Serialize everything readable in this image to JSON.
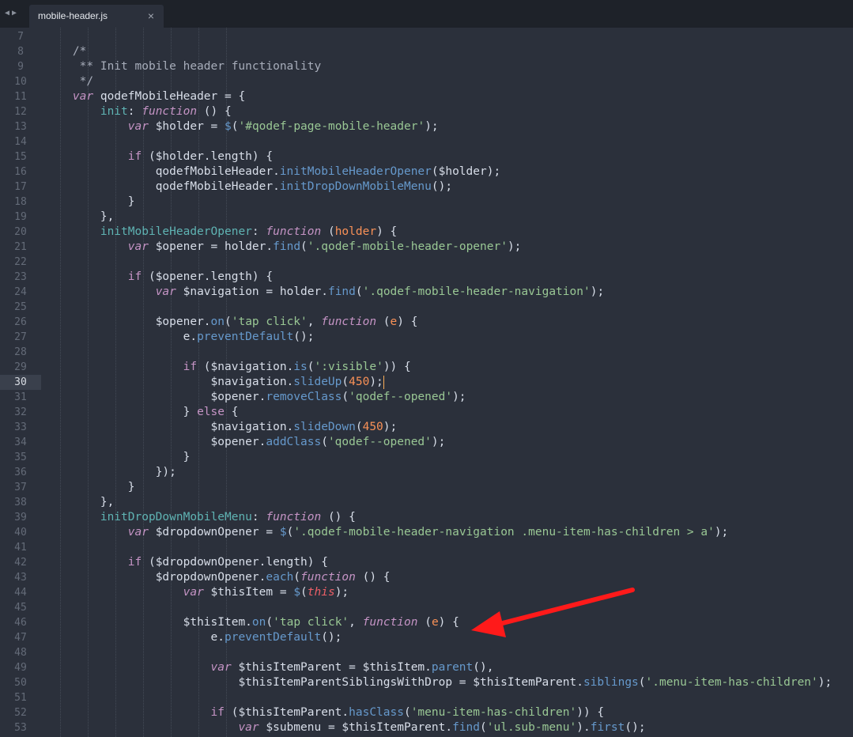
{
  "editor": {
    "tab": {
      "label": "mobile-header.js",
      "close_glyph": "×",
      "active": true
    },
    "cursor_line": 30,
    "lines": [
      {
        "n": 7,
        "i": 0,
        "tokens": []
      },
      {
        "n": 8,
        "i": 2,
        "tokens": [
          {
            "t": "/*",
            "c": "c"
          }
        ]
      },
      {
        "n": 9,
        "i": 2,
        "tokens": [
          {
            "t": " ** Init mobile header functionality",
            "c": "c"
          }
        ]
      },
      {
        "n": 10,
        "i": 2,
        "tokens": [
          {
            "t": " */",
            "c": "c"
          }
        ]
      },
      {
        "n": 11,
        "i": 2,
        "tokens": [
          {
            "t": "var",
            "c": "k"
          },
          {
            "t": " qodefMobileHeader ",
            "c": "v"
          },
          {
            "t": "=",
            "c": "v"
          },
          {
            "t": " {",
            "c": "v"
          }
        ]
      },
      {
        "n": 12,
        "i": 4,
        "tokens": [
          {
            "t": "init",
            "c": "pr"
          },
          {
            "t": ": ",
            "c": "v"
          },
          {
            "t": "function",
            "c": "k"
          },
          {
            "t": " () {",
            "c": "v"
          }
        ]
      },
      {
        "n": 13,
        "i": 6,
        "tokens": [
          {
            "t": "var",
            "c": "k"
          },
          {
            "t": " $holder ",
            "c": "v"
          },
          {
            "t": "=",
            "c": "v"
          },
          {
            "t": " ",
            "c": "v"
          },
          {
            "t": "$",
            "c": "f"
          },
          {
            "t": "(",
            "c": "v"
          },
          {
            "t": "'#qodef-page-mobile-header'",
            "c": "s"
          },
          {
            "t": ");",
            "c": "v"
          }
        ]
      },
      {
        "n": 14,
        "i": 0,
        "tokens": []
      },
      {
        "n": 15,
        "i": 6,
        "tokens": [
          {
            "t": "if",
            "c": "kk"
          },
          {
            "t": " ($holder.length) {",
            "c": "v"
          }
        ]
      },
      {
        "n": 16,
        "i": 8,
        "tokens": [
          {
            "t": "qodefMobileHeader.",
            "c": "v"
          },
          {
            "t": "initMobileHeaderOpener",
            "c": "f"
          },
          {
            "t": "($holder);",
            "c": "v"
          }
        ]
      },
      {
        "n": 17,
        "i": 8,
        "tokens": [
          {
            "t": "qodefMobileHeader.",
            "c": "v"
          },
          {
            "t": "initDropDownMobileMenu",
            "c": "f"
          },
          {
            "t": "();",
            "c": "v"
          }
        ]
      },
      {
        "n": 18,
        "i": 6,
        "tokens": [
          {
            "t": "}",
            "c": "v"
          }
        ]
      },
      {
        "n": 19,
        "i": 4,
        "tokens": [
          {
            "t": "},",
            "c": "v"
          }
        ]
      },
      {
        "n": 20,
        "i": 4,
        "tokens": [
          {
            "t": "initMobileHeaderOpener",
            "c": "pr"
          },
          {
            "t": ": ",
            "c": "v"
          },
          {
            "t": "function",
            "c": "k"
          },
          {
            "t": " (",
            "c": "v"
          },
          {
            "t": "holder",
            "c": "p"
          },
          {
            "t": ") {",
            "c": "v"
          }
        ]
      },
      {
        "n": 21,
        "i": 6,
        "tokens": [
          {
            "t": "var",
            "c": "k"
          },
          {
            "t": " $opener ",
            "c": "v"
          },
          {
            "t": "=",
            "c": "v"
          },
          {
            "t": " holder.",
            "c": "v"
          },
          {
            "t": "find",
            "c": "f"
          },
          {
            "t": "(",
            "c": "v"
          },
          {
            "t": "'.qodef-mobile-header-opener'",
            "c": "s"
          },
          {
            "t": ");",
            "c": "v"
          }
        ]
      },
      {
        "n": 22,
        "i": 0,
        "tokens": []
      },
      {
        "n": 23,
        "i": 6,
        "tokens": [
          {
            "t": "if",
            "c": "kk"
          },
          {
            "t": " ($opener.length) {",
            "c": "v"
          }
        ]
      },
      {
        "n": 24,
        "i": 8,
        "tokens": [
          {
            "t": "var",
            "c": "k"
          },
          {
            "t": " $navigation ",
            "c": "v"
          },
          {
            "t": "=",
            "c": "v"
          },
          {
            "t": " holder.",
            "c": "v"
          },
          {
            "t": "find",
            "c": "f"
          },
          {
            "t": "(",
            "c": "v"
          },
          {
            "t": "'.qodef-mobile-header-navigation'",
            "c": "s"
          },
          {
            "t": ");",
            "c": "v"
          }
        ]
      },
      {
        "n": 25,
        "i": 0,
        "tokens": []
      },
      {
        "n": 26,
        "i": 8,
        "tokens": [
          {
            "t": "$opener.",
            "c": "v"
          },
          {
            "t": "on",
            "c": "f"
          },
          {
            "t": "(",
            "c": "v"
          },
          {
            "t": "'tap click'",
            "c": "s"
          },
          {
            "t": ", ",
            "c": "v"
          },
          {
            "t": "function",
            "c": "k"
          },
          {
            "t": " (",
            "c": "v"
          },
          {
            "t": "e",
            "c": "p"
          },
          {
            "t": ") {",
            "c": "v"
          }
        ]
      },
      {
        "n": 27,
        "i": 10,
        "tokens": [
          {
            "t": "e.",
            "c": "v"
          },
          {
            "t": "preventDefault",
            "c": "f"
          },
          {
            "t": "();",
            "c": "v"
          }
        ]
      },
      {
        "n": 28,
        "i": 0,
        "tokens": []
      },
      {
        "n": 29,
        "i": 10,
        "tokens": [
          {
            "t": "if",
            "c": "kk"
          },
          {
            "t": " ($navigation.",
            "c": "v"
          },
          {
            "t": "is",
            "c": "f"
          },
          {
            "t": "(",
            "c": "v"
          },
          {
            "t": "':visible'",
            "c": "s"
          },
          {
            "t": ")) {",
            "c": "v"
          }
        ]
      },
      {
        "n": 30,
        "i": 12,
        "tokens": [
          {
            "t": "$navigation.",
            "c": "v"
          },
          {
            "t": "slideUp",
            "c": "f"
          },
          {
            "t": "(",
            "c": "v"
          },
          {
            "t": "450",
            "c": "n"
          },
          {
            "t": ");",
            "c": "v"
          }
        ]
      },
      {
        "n": 31,
        "i": 12,
        "tokens": [
          {
            "t": "$opener.",
            "c": "v"
          },
          {
            "t": "removeClass",
            "c": "f"
          },
          {
            "t": "(",
            "c": "v"
          },
          {
            "t": "'qodef--opened'",
            "c": "s"
          },
          {
            "t": ");",
            "c": "v"
          }
        ]
      },
      {
        "n": 32,
        "i": 10,
        "tokens": [
          {
            "t": "} ",
            "c": "v"
          },
          {
            "t": "else",
            "c": "kk"
          },
          {
            "t": " {",
            "c": "v"
          }
        ]
      },
      {
        "n": 33,
        "i": 12,
        "tokens": [
          {
            "t": "$navigation.",
            "c": "v"
          },
          {
            "t": "slideDown",
            "c": "f"
          },
          {
            "t": "(",
            "c": "v"
          },
          {
            "t": "450",
            "c": "n"
          },
          {
            "t": ");",
            "c": "v"
          }
        ]
      },
      {
        "n": 34,
        "i": 12,
        "tokens": [
          {
            "t": "$opener.",
            "c": "v"
          },
          {
            "t": "addClass",
            "c": "f"
          },
          {
            "t": "(",
            "c": "v"
          },
          {
            "t": "'qodef--opened'",
            "c": "s"
          },
          {
            "t": ");",
            "c": "v"
          }
        ]
      },
      {
        "n": 35,
        "i": 10,
        "tokens": [
          {
            "t": "}",
            "c": "v"
          }
        ]
      },
      {
        "n": 36,
        "i": 8,
        "tokens": [
          {
            "t": "});",
            "c": "v"
          }
        ]
      },
      {
        "n": 37,
        "i": 6,
        "tokens": [
          {
            "t": "}",
            "c": "v"
          }
        ]
      },
      {
        "n": 38,
        "i": 4,
        "tokens": [
          {
            "t": "},",
            "c": "v"
          }
        ]
      },
      {
        "n": 39,
        "i": 4,
        "tokens": [
          {
            "t": "initDropDownMobileMenu",
            "c": "pr"
          },
          {
            "t": ": ",
            "c": "v"
          },
          {
            "t": "function",
            "c": "k"
          },
          {
            "t": " () {",
            "c": "v"
          }
        ]
      },
      {
        "n": 40,
        "i": 6,
        "tokens": [
          {
            "t": "var",
            "c": "k"
          },
          {
            "t": " $dropdownOpener ",
            "c": "v"
          },
          {
            "t": "=",
            "c": "v"
          },
          {
            "t": " ",
            "c": "v"
          },
          {
            "t": "$",
            "c": "f"
          },
          {
            "t": "(",
            "c": "v"
          },
          {
            "t": "'.qodef-mobile-header-navigation .menu-item-has-children > a'",
            "c": "s"
          },
          {
            "t": ");",
            "c": "v"
          }
        ]
      },
      {
        "n": 41,
        "i": 0,
        "tokens": []
      },
      {
        "n": 42,
        "i": 6,
        "tokens": [
          {
            "t": "if",
            "c": "kk"
          },
          {
            "t": " ($dropdownOpener.length) {",
            "c": "v"
          }
        ]
      },
      {
        "n": 43,
        "i": 8,
        "tokens": [
          {
            "t": "$dropdownOpener.",
            "c": "v"
          },
          {
            "t": "each",
            "c": "f"
          },
          {
            "t": "(",
            "c": "v"
          },
          {
            "t": "function",
            "c": "k"
          },
          {
            "t": " () {",
            "c": "v"
          }
        ]
      },
      {
        "n": 44,
        "i": 10,
        "tokens": [
          {
            "t": "var",
            "c": "k"
          },
          {
            "t": " $thisItem ",
            "c": "v"
          },
          {
            "t": "=",
            "c": "v"
          },
          {
            "t": " ",
            "c": "v"
          },
          {
            "t": "$",
            "c": "f"
          },
          {
            "t": "(",
            "c": "v"
          },
          {
            "t": "this",
            "c": "t"
          },
          {
            "t": ");",
            "c": "v"
          }
        ]
      },
      {
        "n": 45,
        "i": 0,
        "tokens": []
      },
      {
        "n": 46,
        "i": 10,
        "tokens": [
          {
            "t": "$thisItem.",
            "c": "v"
          },
          {
            "t": "on",
            "c": "f"
          },
          {
            "t": "(",
            "c": "v"
          },
          {
            "t": "'tap click'",
            "c": "s"
          },
          {
            "t": ", ",
            "c": "v"
          },
          {
            "t": "function",
            "c": "k"
          },
          {
            "t": " (",
            "c": "v"
          },
          {
            "t": "e",
            "c": "p"
          },
          {
            "t": ") {",
            "c": "v"
          }
        ]
      },
      {
        "n": 47,
        "i": 12,
        "tokens": [
          {
            "t": "e.",
            "c": "v"
          },
          {
            "t": "preventDefault",
            "c": "f"
          },
          {
            "t": "();",
            "c": "v"
          }
        ]
      },
      {
        "n": 48,
        "i": 0,
        "tokens": []
      },
      {
        "n": 49,
        "i": 12,
        "tokens": [
          {
            "t": "var",
            "c": "k"
          },
          {
            "t": " $thisItemParent ",
            "c": "v"
          },
          {
            "t": "=",
            "c": "v"
          },
          {
            "t": " $thisItem.",
            "c": "v"
          },
          {
            "t": "parent",
            "c": "f"
          },
          {
            "t": "(),",
            "c": "v"
          }
        ]
      },
      {
        "n": 50,
        "i": 14,
        "tokens": [
          {
            "t": "$thisItemParentSiblingsWithDrop ",
            "c": "v"
          },
          {
            "t": "=",
            "c": "v"
          },
          {
            "t": " $thisItemParent.",
            "c": "v"
          },
          {
            "t": "siblings",
            "c": "f"
          },
          {
            "t": "(",
            "c": "v"
          },
          {
            "t": "'.menu-item-has-children'",
            "c": "s"
          },
          {
            "t": ");",
            "c": "v"
          }
        ]
      },
      {
        "n": 51,
        "i": 0,
        "tokens": []
      },
      {
        "n": 52,
        "i": 12,
        "tokens": [
          {
            "t": "if",
            "c": "kk"
          },
          {
            "t": " ($thisItemParent.",
            "c": "v"
          },
          {
            "t": "hasClass",
            "c": "f"
          },
          {
            "t": "(",
            "c": "v"
          },
          {
            "t": "'menu-item-has-children'",
            "c": "s"
          },
          {
            "t": ")) {",
            "c": "v"
          }
        ]
      },
      {
        "n": 53,
        "i": 14,
        "tokens": [
          {
            "t": "var",
            "c": "k"
          },
          {
            "t": " $submenu ",
            "c": "v"
          },
          {
            "t": "=",
            "c": "v"
          },
          {
            "t": " $thisItemParent.",
            "c": "v"
          },
          {
            "t": "find",
            "c": "f"
          },
          {
            "t": "(",
            "c": "v"
          },
          {
            "t": "'ul.sub-menu'",
            "c": "s"
          },
          {
            "t": ").",
            "c": "v"
          },
          {
            "t": "first",
            "c": "f"
          },
          {
            "t": "();",
            "c": "v"
          }
        ]
      }
    ]
  },
  "annotation": {
    "type": "red-arrow",
    "color": "#ff1a1a",
    "points_to_line": 46
  },
  "colors": {
    "background": "#2b303b",
    "tabbar": "#1e2229",
    "gutter_text": "#646b78"
  },
  "icons": {
    "nav_back": "triangle-left-icon",
    "nav_forward": "triangle-right-icon",
    "close": "close-icon"
  }
}
